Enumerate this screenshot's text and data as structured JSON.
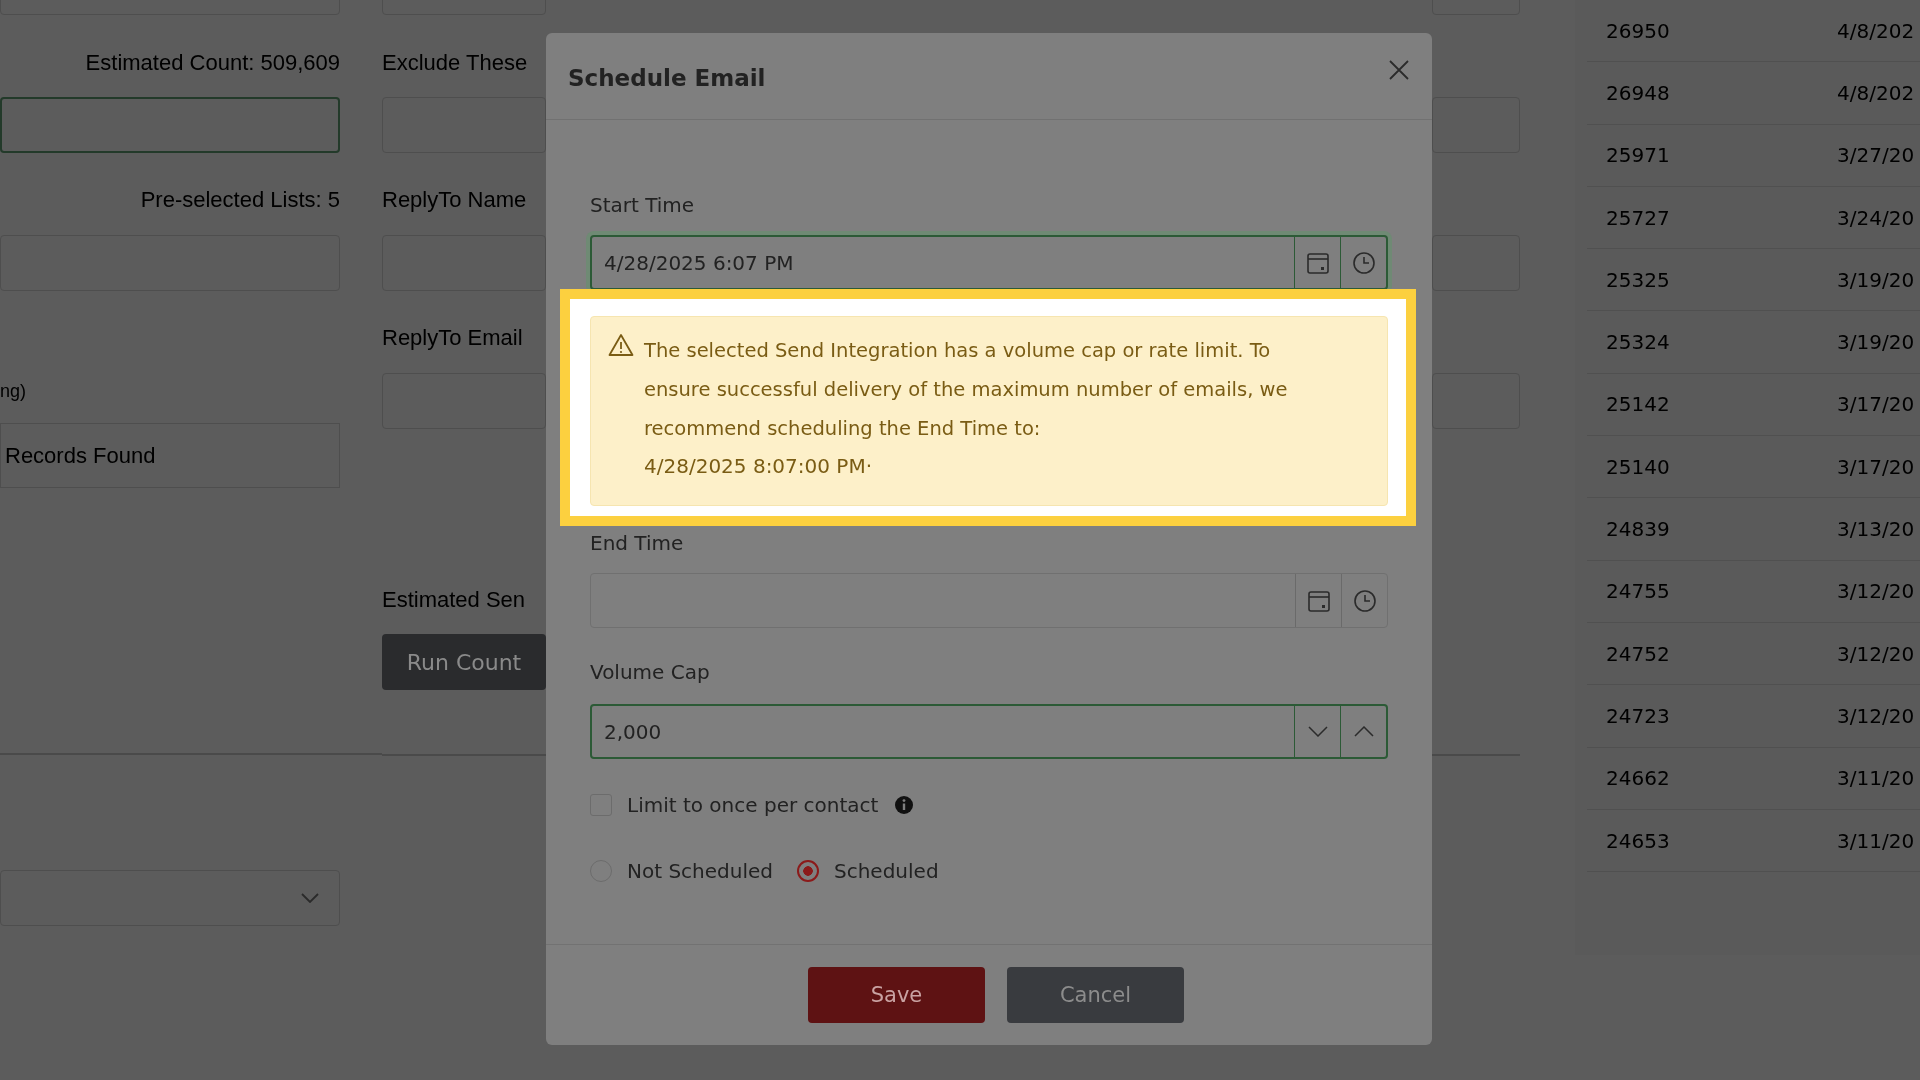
{
  "background": {
    "left": {
      "estimated_count": "Estimated Count: 509,609",
      "preselected_lists": "Pre-selected Lists: 5",
      "note": "ng)",
      "records_text": "Records Found"
    },
    "middle": {
      "exclude_label": "Exclude These",
      "reply_to_name_label": "ReplyTo Name",
      "reply_to_email_label": "ReplyTo Email",
      "estimated_send_label": "Estimated Sen",
      "run_count_button": "Run Count"
    },
    "table": {
      "rows": [
        {
          "column_1": "26950",
          "column_2": "4/8/202"
        },
        {
          "column_1": "26948",
          "column_2": "4/8/202"
        },
        {
          "column_1": "25971",
          "column_2": "3/27/20"
        },
        {
          "column_1": "25727",
          "column_2": "3/24/20"
        },
        {
          "column_1": "25325",
          "column_2": "3/19/20"
        },
        {
          "column_1": "25324",
          "column_2": "3/19/20"
        },
        {
          "column_1": "25142",
          "column_2": "3/17/20"
        },
        {
          "column_1": "25140",
          "column_2": "3/17/20"
        },
        {
          "column_1": "24839",
          "column_2": "3/13/20"
        },
        {
          "column_1": "24755",
          "column_2": "3/12/20"
        },
        {
          "column_1": "24752",
          "column_2": "3/12/20"
        },
        {
          "column_1": "24723",
          "column_2": "3/12/20"
        },
        {
          "column_1": "24662",
          "column_2": "3/11/20"
        },
        {
          "column_1": "24653",
          "column_2": "3/11/20"
        }
      ]
    }
  },
  "modal": {
    "title": "Schedule Email",
    "start_time": {
      "label": "Start Time",
      "value": "4/28/2025 6:07 PM",
      "focused": true
    },
    "alert": {
      "text": "The selected Send Integration has a volume cap or rate limit. To ensure successful delivery of the maximum number of emails, we recommend scheduling the End Time to:",
      "recommended": "4/28/2025 8:07:00 PM·"
    },
    "end_time": {
      "label": "End Time",
      "focused": false
    },
    "volume_cap": {
      "label": "Volume Cap",
      "value": "2,000",
      "focused": true
    },
    "limit_checkbox": {
      "label": "Limit to once per contact",
      "checked": false
    },
    "schedule_options": [
      {
        "label": "Not Scheduled",
        "selected": false
      },
      {
        "label": "Scheduled",
        "selected": true
      }
    ],
    "buttons": [
      {
        "label": "Save",
        "kind": "primary"
      },
      {
        "label": "Cancel",
        "kind": "secondary"
      }
    ]
  }
}
